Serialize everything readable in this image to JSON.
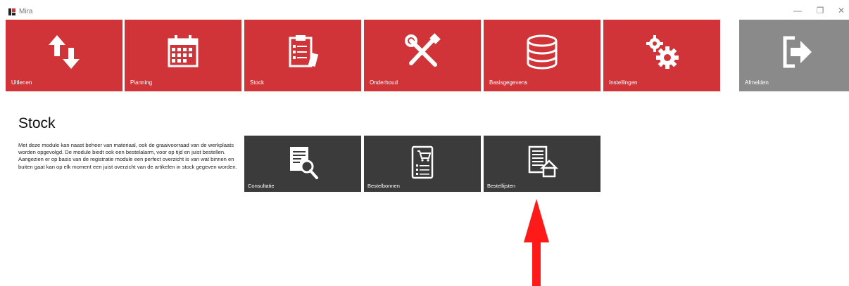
{
  "window": {
    "title": "Mira",
    "controls": {
      "minimize": "—",
      "maximize": "❐",
      "close": "✕"
    }
  },
  "colors": {
    "tile_red": "#d13438",
    "tile_gray": "#8a8a8a",
    "subtile_dark": "#3b3b3b",
    "annotation_arrow": "#ff1a1a"
  },
  "nav": [
    {
      "label": "Uitlenen",
      "icon": "swap-arrows-icon"
    },
    {
      "label": "Planning",
      "icon": "calendar-icon"
    },
    {
      "label": "Stock",
      "icon": "clipboard-checklist-icon"
    },
    {
      "label": "Onderhoud",
      "icon": "tools-icon"
    },
    {
      "label": "Basisgegevens",
      "icon": "database-icon"
    },
    {
      "label": "Instellingen",
      "icon": "gears-icon"
    },
    {
      "label": "Afmelden",
      "icon": "sign-out-icon"
    }
  ],
  "section": {
    "title": "Stock",
    "description": "Met deze module kan naast beheer van materiaal, ook de graaivoorraad van de werkplaats worden opgevolgd. De module biedt ook een bestelalarm, voor op tijd en juist bestellen. Aangezien er op basis van de registratie module een perfect overzicht is van wat binnen en buiten gaat kan op elk moment een juist overzicht van de artikelen in stock gegeven worden."
  },
  "submodules": [
    {
      "label": "Consultatie",
      "icon": "document-search-icon"
    },
    {
      "label": "Bestelbonnen",
      "icon": "order-receipt-icon"
    },
    {
      "label": "Bestellijsten",
      "icon": "order-list-basket-icon"
    }
  ]
}
